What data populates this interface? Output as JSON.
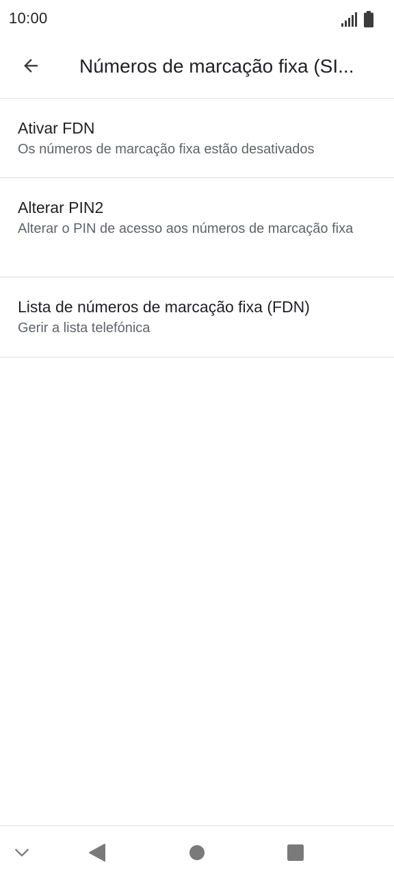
{
  "status_bar": {
    "time": "10:00",
    "icons": [
      "signal-icon",
      "battery-icon"
    ]
  },
  "app_bar": {
    "title": "Números de marcação fixa (SI...",
    "back_icon": "arrow-back-icon"
  },
  "preferences": [
    {
      "title": "Ativar FDN",
      "summary": "Os números de marcação fixa estão desativados"
    },
    {
      "title": "Alterar PIN2",
      "summary": "Alterar o PIN de acesso aos números de marcação fixa"
    },
    {
      "title": "Lista de números de marcação fixa (FDN)",
      "summary": "Gerir a lista telefónica"
    }
  ],
  "nav_bar": {
    "buttons": [
      "chevron-down-icon",
      "back-triangle-icon",
      "home-circle-icon",
      "recents-square-icon"
    ]
  },
  "colors": {
    "text_primary": "#202124",
    "text_secondary": "#5f6368",
    "divider": "#dcdcdc",
    "nav_icon": "#7a7a7a"
  }
}
